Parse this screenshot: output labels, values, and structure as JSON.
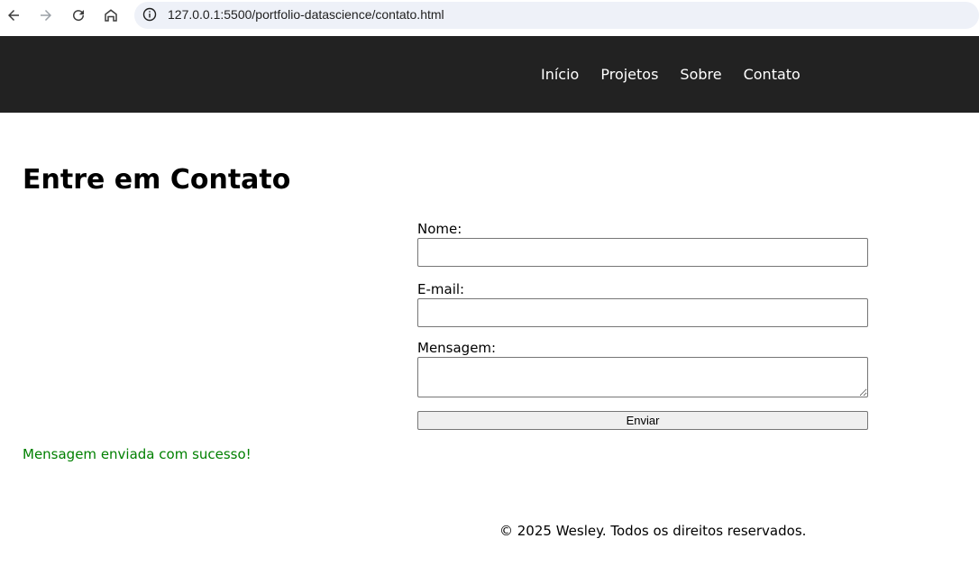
{
  "browser": {
    "url": "127.0.0.1:5500/portfolio-datascience/contato.html"
  },
  "nav": {
    "items": [
      {
        "label": "Início"
      },
      {
        "label": "Projetos"
      },
      {
        "label": "Sobre"
      },
      {
        "label": "Contato"
      }
    ]
  },
  "main": {
    "title": "Entre em Contato",
    "form": {
      "name_label": "Nome:",
      "name_value": "",
      "email_label": "E-mail:",
      "email_value": "",
      "message_label": "Mensagem:",
      "message_value": "",
      "submit_label": "Enviar"
    },
    "success_message": "Mensagem enviada com sucesso!"
  },
  "footer": {
    "text": "© 2025 Wesley. Todos os direitos reservados."
  },
  "colors": {
    "header_bg": "#222222",
    "success_text": "#008000"
  }
}
